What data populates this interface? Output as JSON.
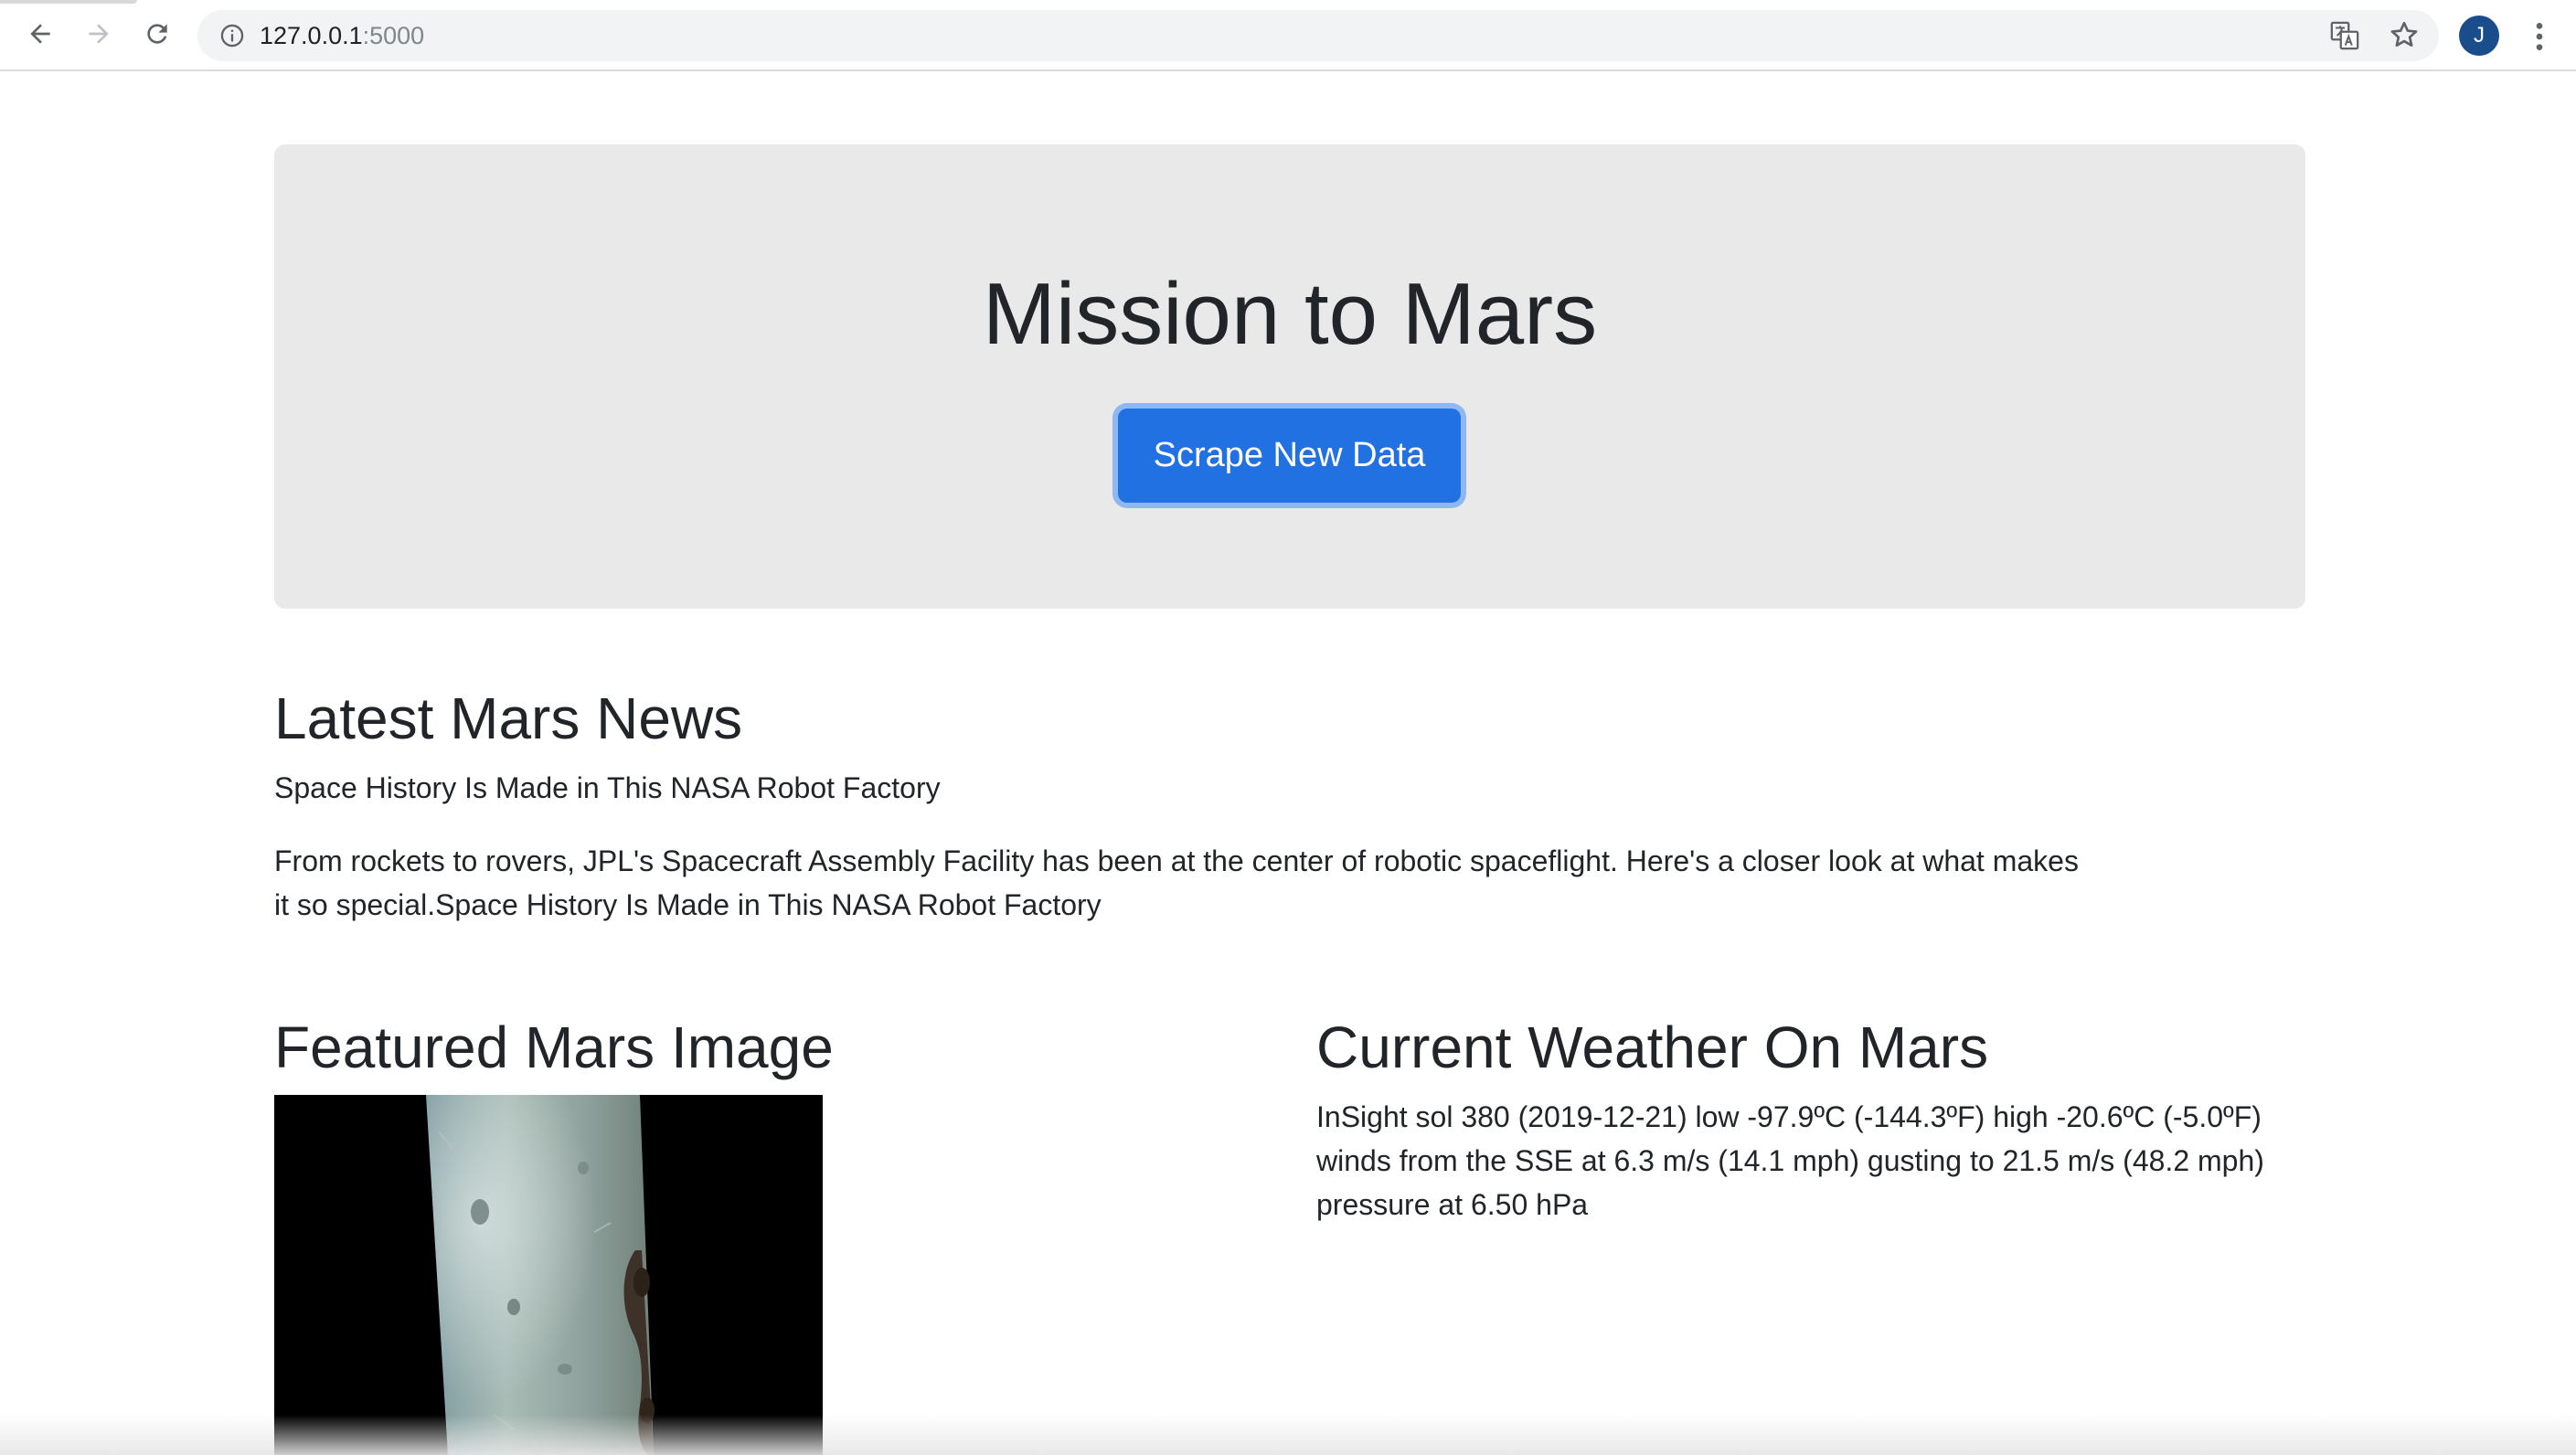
{
  "browser": {
    "url_host": "127.0.0.1",
    "url_port": ":5000",
    "avatar_initial": "J",
    "icons": [
      "back-arrow-icon",
      "forward-arrow-icon",
      "reload-icon",
      "info-icon",
      "translate-icon",
      "star-icon",
      "menu-icon"
    ]
  },
  "jumbotron": {
    "title": "Mission to Mars",
    "button_label": "Scrape New Data",
    "button_color": "#2271e3"
  },
  "news": {
    "heading": "Latest Mars News",
    "headline": "Space History Is Made in This NASA Robot Factory",
    "body_line1": "From rockets to rovers, JPL's Spacecraft Assembly Facility has been at the center of robotic spaceflight. Here's a closer look at what makes",
    "body_line2": "it so special.Space History Is Made in This NASA Robot Factory"
  },
  "featured": {
    "heading": "Featured Mars Image"
  },
  "weather": {
    "heading": "Current Weather On Mars",
    "line1": "InSight sol 380 (2019-12-21) low -97.9ºC (-144.3ºF) high -20.6ºC (-5.0ºF)",
    "line2": "winds from the SSE at 6.3 m/s (14.1 mph) gusting to 21.5 m/s (48.2 mph)",
    "line3": "pressure at 6.50 hPa"
  }
}
